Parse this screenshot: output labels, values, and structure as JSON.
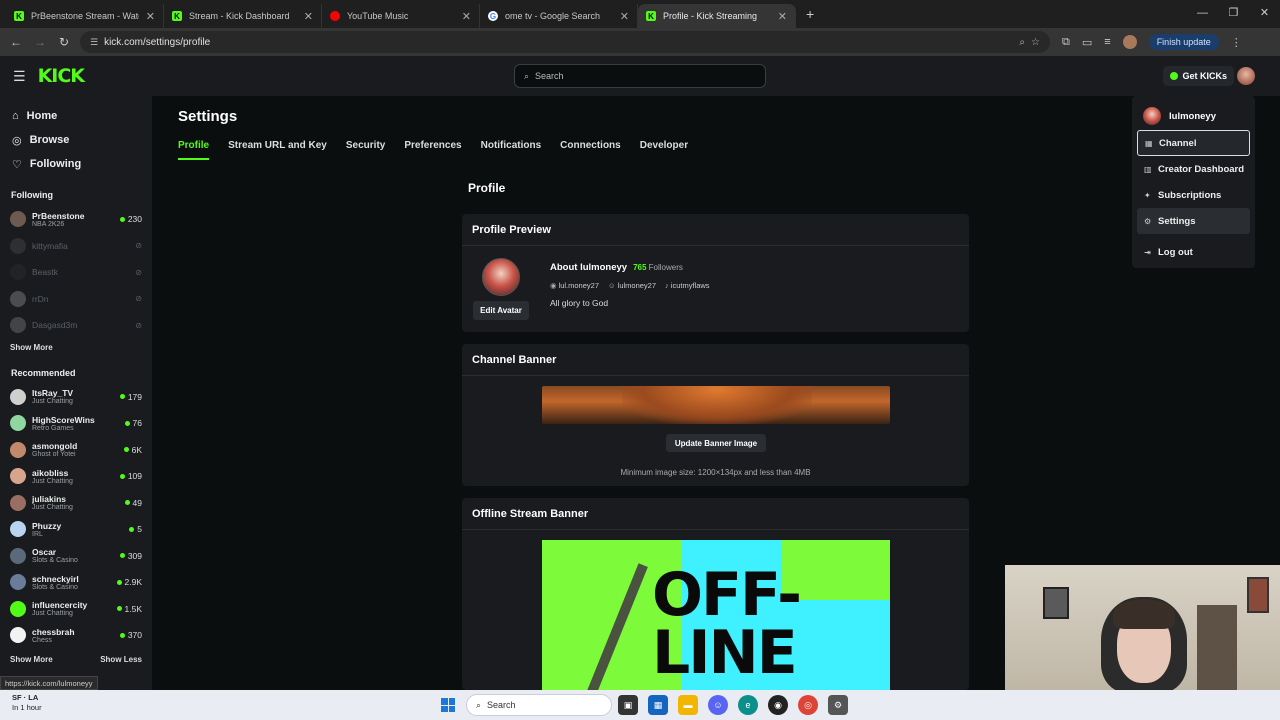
{
  "browser": {
    "tabs": [
      {
        "title": "PrBeenstone Stream - Watch Li",
        "icon": "kick"
      },
      {
        "title": "Stream - Kick Dashboard",
        "icon": "kick"
      },
      {
        "title": "YouTube Music",
        "icon": "youtube-music"
      },
      {
        "title": "ome tv - Google Search",
        "icon": "google"
      },
      {
        "title": "Profile - Kick Streaming",
        "icon": "kick",
        "active": true
      }
    ],
    "url": "kick.com/settings/profile",
    "finish_update": "Finish update",
    "status_url": "https://kick.com/lulmoneyy"
  },
  "header": {
    "logo": "KICK",
    "search_placeholder": "Search",
    "get_kicks": "Get KICKs"
  },
  "sidebar": {
    "nav": [
      {
        "label": "Home",
        "icon": "home-icon"
      },
      {
        "label": "Browse",
        "icon": "compass-icon"
      },
      {
        "label": "Following",
        "icon": "heart-icon"
      }
    ],
    "following_title": "Following",
    "following": [
      {
        "name": "PrBeenstone",
        "category": "NBA 2K26",
        "viewers": "230",
        "live": true,
        "color": "#6d5a50"
      },
      {
        "name": "kittymafia",
        "category": "",
        "viewers": "",
        "live": false,
        "color": "#4a4a4a"
      },
      {
        "name": "Beastk",
        "category": "",
        "viewers": "",
        "live": false,
        "color": "#2f2f2f"
      },
      {
        "name": "rrDn",
        "category": "",
        "viewers": "",
        "live": false,
        "color": "#8a8a8a"
      },
      {
        "name": "Dasgasd3m",
        "category": "",
        "viewers": "",
        "live": false,
        "color": "#777777"
      }
    ],
    "show_more": "Show More",
    "recommended_title": "Recommended",
    "recommended": [
      {
        "name": "ItsRay_TV",
        "category": "Just Chatting",
        "viewers": "179",
        "color": "#cfcfcf"
      },
      {
        "name": "HighScoreWins",
        "category": "Retro Games",
        "viewers": "76",
        "color": "#8fd6a0"
      },
      {
        "name": "asmongold",
        "category": "Ghost of Yotei",
        "viewers": "6K",
        "color": "#c08a6a"
      },
      {
        "name": "aikobliss",
        "category": "Just Chatting",
        "viewers": "109",
        "color": "#d7a58c"
      },
      {
        "name": "juliakins",
        "category": "Just Chatting",
        "viewers": "49",
        "color": "#9a6e62"
      },
      {
        "name": "Phuzzy",
        "category": "IRL",
        "viewers": "5",
        "color": "#b9d3f0"
      },
      {
        "name": "Oscar",
        "category": "Slots & Casino",
        "viewers": "309",
        "color": "#5a6a7a"
      },
      {
        "name": "schneckyirl",
        "category": "Slots & Casino",
        "viewers": "2.9K",
        "color": "#6a7c9a"
      },
      {
        "name": "influencercity",
        "category": "Just Chatting",
        "viewers": "1.5K",
        "color": "#53fc18"
      },
      {
        "name": "chessbrah",
        "category": "Chess",
        "viewers": "370",
        "color": "#f2f2f2"
      }
    ],
    "show_more_2": "Show More",
    "show_less": "Show Less"
  },
  "main": {
    "title": "Settings",
    "tabs": [
      "Profile",
      "Stream URL and Key",
      "Security",
      "Preferences",
      "Notifications",
      "Connections",
      "Developer"
    ],
    "active_tab": "Profile",
    "section_title": "Profile",
    "preview": {
      "header": "Profile Preview",
      "about": "About lulmoneyy",
      "followers_count": "765",
      "followers_label": "Followers",
      "socials": [
        {
          "icon": "instagram-icon",
          "handle": "lul.money27"
        },
        {
          "icon": "discord-icon",
          "handle": "lulmoney27"
        },
        {
          "icon": "tiktok-icon",
          "handle": "icutmyflaws"
        }
      ],
      "bio": "All glory to God",
      "edit_avatar": "Edit Avatar"
    },
    "channel_banner": {
      "header": "Channel Banner",
      "update_button": "Update Banner Image",
      "hint": "Minimum image size: 1200×134px and less than 4MB"
    },
    "offline_banner": {
      "header": "Offline Stream Banner",
      "image_text": "OFF-\nLINE"
    }
  },
  "dropdown": {
    "username": "lulmoneyy",
    "items": [
      {
        "label": "Channel",
        "icon": "channel-icon",
        "state": "focus"
      },
      {
        "label": "Creator Dashboard",
        "icon": "dashboard-icon"
      },
      {
        "label": "Subscriptions",
        "icon": "star-icon"
      },
      {
        "label": "Settings",
        "icon": "gear-icon",
        "state": "hover"
      },
      {
        "label": "Log out",
        "icon": "logout-icon"
      }
    ]
  },
  "taskbar": {
    "weather_temp": "SF · LA",
    "weather_sub": "In 1 hour",
    "search_placeholder": "Search"
  },
  "colors": {
    "accent": "#53fc18",
    "panel": "#191b1f",
    "background": "#0b0e0f"
  }
}
